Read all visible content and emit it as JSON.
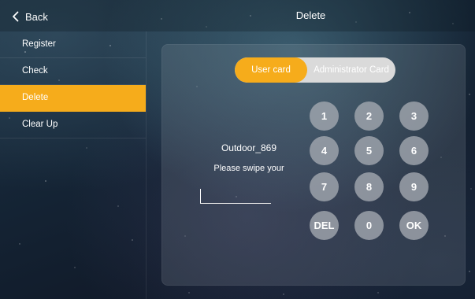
{
  "header": {
    "back_label": "Back",
    "title": "Delete"
  },
  "sidebar": {
    "items": [
      {
        "label": "Register",
        "active": false
      },
      {
        "label": "Check",
        "active": false
      },
      {
        "label": "Delete",
        "active": true
      },
      {
        "label": "Clear Up",
        "active": false
      }
    ]
  },
  "card_type": {
    "options": [
      "User card",
      "Administrator Card"
    ],
    "selected": "User card"
  },
  "device": {
    "name": "Outdoor_869"
  },
  "prompt": "Please swipe your",
  "card_input": {
    "value": ""
  },
  "keypad": {
    "keys": [
      "1",
      "2",
      "3",
      "4",
      "5",
      "6",
      "7",
      "8",
      "9",
      "DEL",
      "0",
      "OK"
    ]
  },
  "icons": {
    "back": "chevron-left-icon"
  },
  "colors": {
    "accent": "#f6ac1b",
    "segment_inactive": "#dadada",
    "key": "#a5aab2"
  }
}
